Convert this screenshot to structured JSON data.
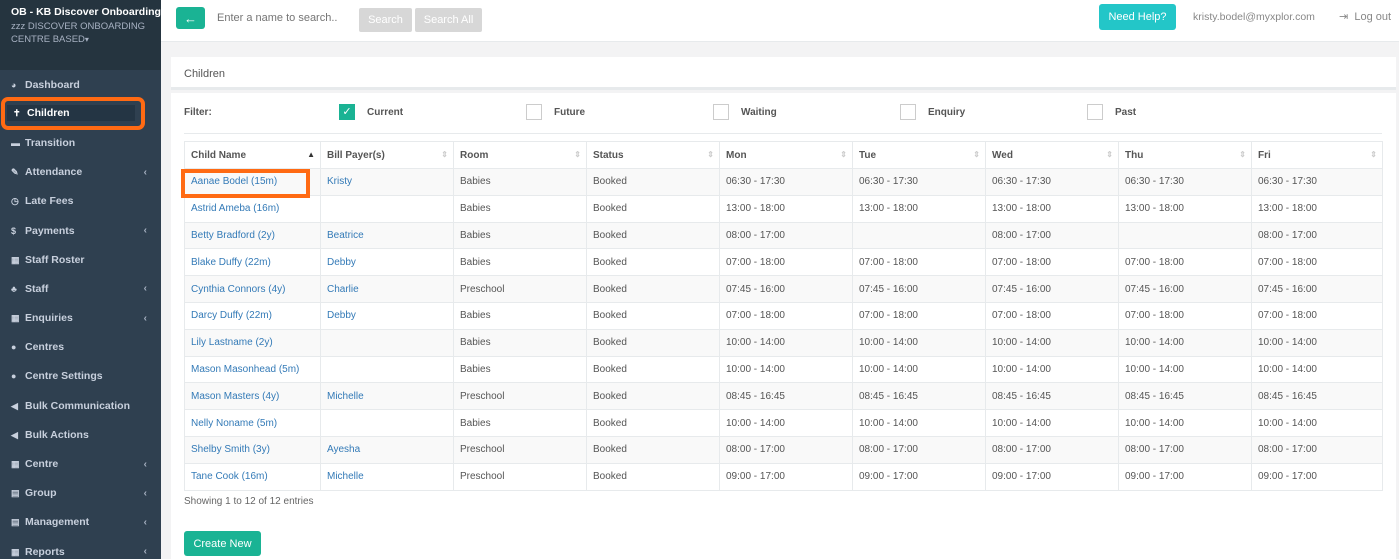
{
  "org": {
    "name": "OB - KB Discover Onboarding",
    "centre": "zzz DISCOVER ONBOARDING CENTRE BASED"
  },
  "sidebar": {
    "items": [
      {
        "label": "Dashboard",
        "icon": "pie-chart-icon",
        "glyph": "◕",
        "submenu": false
      },
      {
        "label": "Children",
        "icon": "child-icon",
        "glyph": "✝",
        "submenu": false,
        "active": true
      },
      {
        "label": "Transition",
        "icon": "graduation-icon",
        "glyph": "▬",
        "submenu": false
      },
      {
        "label": "Attendance",
        "icon": "edit-icon",
        "glyph": "✎",
        "submenu": true
      },
      {
        "label": "Late Fees",
        "icon": "clock-icon",
        "glyph": "◷",
        "submenu": false
      },
      {
        "label": "Payments",
        "icon": "dollar-icon",
        "glyph": "$",
        "submenu": true
      },
      {
        "label": "Staff Roster",
        "icon": "calendar-icon",
        "glyph": "▦",
        "submenu": false
      },
      {
        "label": "Staff",
        "icon": "sitemap-icon",
        "glyph": "♣",
        "submenu": true
      },
      {
        "label": "Enquiries",
        "icon": "grid-icon",
        "glyph": "▦",
        "submenu": true
      },
      {
        "label": "Centres",
        "icon": "circle-icon",
        "glyph": "●",
        "submenu": false
      },
      {
        "label": "Centre Settings",
        "icon": "circle-icon",
        "glyph": "●",
        "submenu": false
      },
      {
        "label": "Bulk Communication",
        "icon": "bullhorn-icon",
        "glyph": "◀",
        "submenu": false
      },
      {
        "label": "Bulk Actions",
        "icon": "bullhorn-icon",
        "glyph": "◀",
        "submenu": false
      },
      {
        "label": "Centre",
        "icon": "grid-icon",
        "glyph": "▦",
        "submenu": true
      },
      {
        "label": "Group",
        "icon": "list-icon",
        "glyph": "▤",
        "submenu": true
      },
      {
        "label": "Management",
        "icon": "table-icon",
        "glyph": "▤",
        "submenu": true
      },
      {
        "label": "Reports",
        "icon": "calendar-icon",
        "glyph": "▦",
        "submenu": true
      }
    ]
  },
  "topbar": {
    "back_glyph": "←",
    "search_placeholder": "Enter a name to search..",
    "search_label": "Search",
    "search_all_label": "Search All",
    "help_label": "Need Help?",
    "user_email": "kristy.bodel@myxplor.com",
    "logout_label": "Log out"
  },
  "panel": {
    "title": "Children"
  },
  "filter": {
    "label": "Filter:",
    "options": [
      {
        "label": "Current",
        "checked": true
      },
      {
        "label": "Future",
        "checked": false
      },
      {
        "label": "Waiting",
        "checked": false
      },
      {
        "label": "Enquiry",
        "checked": false
      },
      {
        "label": "Past",
        "checked": false
      }
    ]
  },
  "table": {
    "columns": [
      "Child Name",
      "Bill Payer(s)",
      "Room",
      "Status",
      "Mon",
      "Tue",
      "Wed",
      "Thu",
      "Fri"
    ],
    "rows": [
      [
        "Aanae Bodel (15m)",
        "Kristy",
        "Babies",
        "Booked",
        "06:30 - 17:30",
        "06:30 - 17:30",
        "06:30 - 17:30",
        "06:30 - 17:30",
        "06:30 - 17:30"
      ],
      [
        "Astrid Ameba (16m)",
        "",
        "Babies",
        "Booked",
        "13:00 - 18:00",
        "13:00 - 18:00",
        "13:00 - 18:00",
        "13:00 - 18:00",
        "13:00 - 18:00"
      ],
      [
        "Betty Bradford (2y)",
        "Beatrice",
        "Babies",
        "Booked",
        "08:00 - 17:00",
        "",
        "08:00 - 17:00",
        "",
        "08:00 - 17:00"
      ],
      [
        "Blake Duffy (22m)",
        "Debby",
        "Babies",
        "Booked",
        "07:00 - 18:00",
        "07:00 - 18:00",
        "07:00 - 18:00",
        "07:00 - 18:00",
        "07:00 - 18:00"
      ],
      [
        "Cynthia Connors (4y)",
        "Charlie",
        "Preschool",
        "Booked",
        "07:45 - 16:00",
        "07:45 - 16:00",
        "07:45 - 16:00",
        "07:45 - 16:00",
        "07:45 - 16:00"
      ],
      [
        "Darcy Duffy (22m)",
        "Debby",
        "Babies",
        "Booked",
        "07:00 - 18:00",
        "07:00 - 18:00",
        "07:00 - 18:00",
        "07:00 - 18:00",
        "07:00 - 18:00"
      ],
      [
        "Lily Lastname (2y)",
        "",
        "Babies",
        "Booked",
        "10:00 - 14:00",
        "10:00 - 14:00",
        "10:00 - 14:00",
        "10:00 - 14:00",
        "10:00 - 14:00"
      ],
      [
        "Mason Masonhead (5m)",
        "",
        "Babies",
        "Booked",
        "10:00 - 14:00",
        "10:00 - 14:00",
        "10:00 - 14:00",
        "10:00 - 14:00",
        "10:00 - 14:00"
      ],
      [
        "Mason Masters (4y)",
        "Michelle",
        "Preschool",
        "Booked",
        "08:45 - 16:45",
        "08:45 - 16:45",
        "08:45 - 16:45",
        "08:45 - 16:45",
        "08:45 - 16:45"
      ],
      [
        "Nelly Noname (5m)",
        "",
        "Babies",
        "Booked",
        "10:00 - 14:00",
        "10:00 - 14:00",
        "10:00 - 14:00",
        "10:00 - 14:00",
        "10:00 - 14:00"
      ],
      [
        "Shelby Smith (3y)",
        "Ayesha",
        "Preschool",
        "Booked",
        "08:00 - 17:00",
        "08:00 - 17:00",
        "08:00 - 17:00",
        "08:00 - 17:00",
        "08:00 - 17:00"
      ],
      [
        "Tane Cook (16m)",
        "Michelle",
        "Preschool",
        "Booked",
        "09:00 - 17:00",
        "09:00 - 17:00",
        "09:00 - 17:00",
        "09:00 - 17:00",
        "09:00 - 17:00"
      ]
    ],
    "info": "Showing 1 to 12 of 12 entries"
  },
  "create_label": "Create New",
  "colors": {
    "accent": "#1ab394",
    "sidebar": "#2f4050",
    "highlight": "#ff6a13",
    "help": "#23c6c8",
    "link": "#337ab7"
  }
}
